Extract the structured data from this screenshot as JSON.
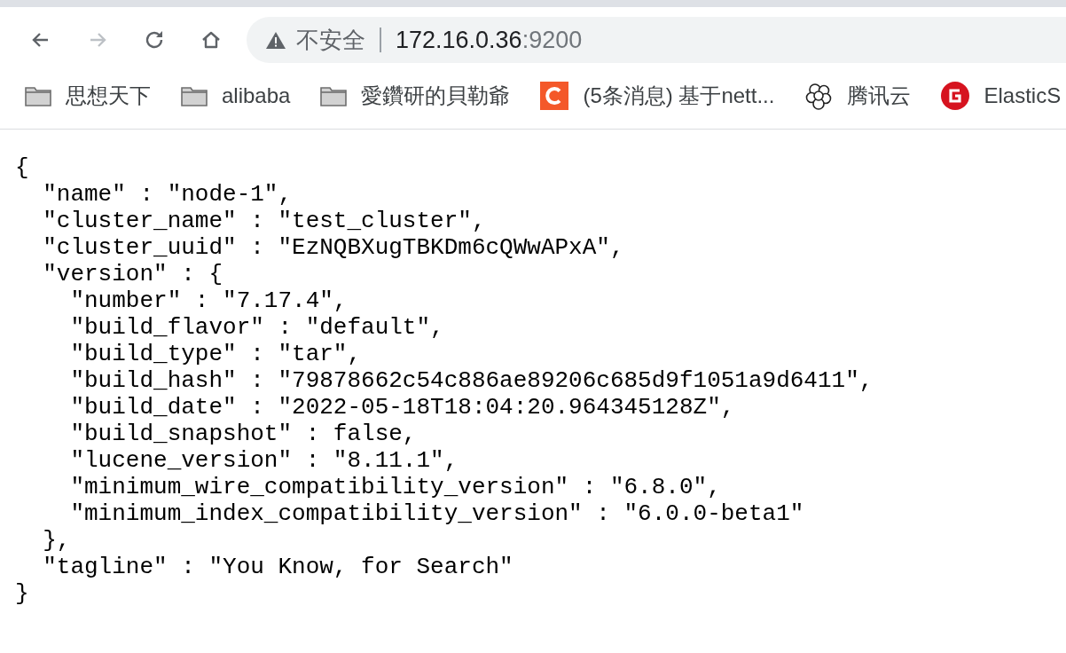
{
  "toolbar": {
    "back_enabled": true,
    "forward_enabled": false,
    "security_label": "不安全",
    "url_host": "172.16.0.36",
    "url_rest": ":9200"
  },
  "bookmarks": [
    {
      "kind": "folder",
      "label": "思想天下"
    },
    {
      "kind": "folder",
      "label": "alibaba"
    },
    {
      "kind": "folder",
      "label": "愛鑽研的貝勒爺"
    },
    {
      "kind": "c-logo",
      "label": "(5条消息) 基于nett..."
    },
    {
      "kind": "cloud",
      "label": "腾讯云"
    },
    {
      "kind": "g-logo",
      "label": "ElasticS"
    }
  ],
  "json_lines": [
    "{",
    "  \"name\" : \"node-1\",",
    "  \"cluster_name\" : \"test_cluster\",",
    "  \"cluster_uuid\" : \"EzNQBXugTBKDm6cQWwAPxA\",",
    "  \"version\" : {",
    "    \"number\" : \"7.17.4\",",
    "    \"build_flavor\" : \"default\",",
    "    \"build_type\" : \"tar\",",
    "    \"build_hash\" : \"79878662c54c886ae89206c685d9f1051a9d6411\",",
    "    \"build_date\" : \"2022-05-18T18:04:20.964345128Z\",",
    "    \"build_snapshot\" : false,",
    "    \"lucene_version\" : \"8.11.1\",",
    "    \"minimum_wire_compatibility_version\" : \"6.8.0\",",
    "    \"minimum_index_compatibility_version\" : \"6.0.0-beta1\"",
    "  },",
    "  \"tagline\" : \"You Know, for Search\"",
    "}"
  ]
}
